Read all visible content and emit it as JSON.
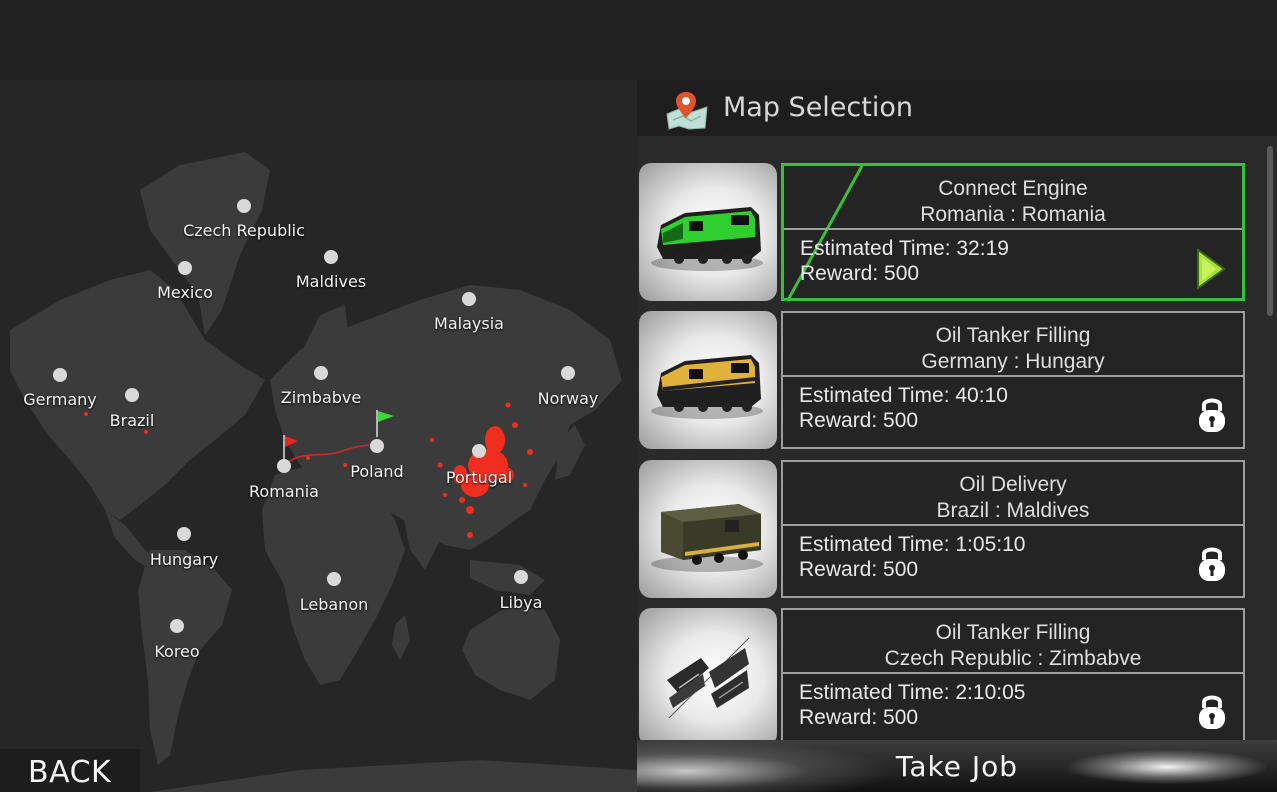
{
  "header": {
    "title": "Map Selection",
    "icon": "map-pin-icon"
  },
  "map": {
    "cities": [
      {
        "id": "czech-republic",
        "name": "Czech Republic"
      },
      {
        "id": "mexico",
        "name": "Mexico"
      },
      {
        "id": "maldives",
        "name": "Maldives"
      },
      {
        "id": "malaysia",
        "name": "Malaysia"
      },
      {
        "id": "germany",
        "name": "Germany"
      },
      {
        "id": "brazil",
        "name": "Brazil"
      },
      {
        "id": "zimbabve",
        "name": "Zimbabve"
      },
      {
        "id": "norway",
        "name": "Norway"
      },
      {
        "id": "poland",
        "name": "Poland"
      },
      {
        "id": "romania",
        "name": "Romania"
      },
      {
        "id": "portugal",
        "name": "Portugal"
      },
      {
        "id": "hungary",
        "name": "Hungary"
      },
      {
        "id": "lebanon",
        "name": "Lebanon"
      },
      {
        "id": "libya",
        "name": "Libya"
      },
      {
        "id": "koreo",
        "name": "Koreo"
      }
    ],
    "route": {
      "start_flag_color": "#e8251e",
      "end_flag_color": "#3ed63a",
      "line_color": "#d8261e"
    }
  },
  "jobs": [
    {
      "name": "Connect Engine",
      "route": "Romania : Romania",
      "time_label": "Estimated Time: 32:19",
      "reward_label": "Reward: 500",
      "status": "selected",
      "action_icon": "play-icon",
      "locomotive_color": "#2fcf2f"
    },
    {
      "name": "Oil Tanker Filling",
      "route": "Germany : Hungary",
      "time_label": "Estimated Time: 40:10",
      "reward_label": "Reward: 500",
      "status": "locked",
      "action_icon": "lock-icon",
      "locomotive_color": "#e0b23a"
    },
    {
      "name": "Oil Delivery",
      "route": "Brazil : Maldives",
      "time_label": "Estimated Time: 1:05:10",
      "reward_label": "Reward: 500",
      "status": "locked",
      "action_icon": "lock-icon",
      "locomotive_color": "#4a4a32"
    },
    {
      "name": "Oil Tanker Filling",
      "route": "Czech Republic : Zimbabve",
      "time_label": "Estimated Time: 2:10:05",
      "reward_label": "Reward: 500",
      "status": "locked",
      "action_icon": "lock-icon",
      "locomotive_color": "#3a3a3a"
    }
  ],
  "buttons": {
    "back": "BACK",
    "take_job": "Take  Job"
  },
  "colors": {
    "accent_selected": "#35c13a",
    "card_border": "#9d9d9d",
    "heat_spot": "#ef2e1f"
  }
}
